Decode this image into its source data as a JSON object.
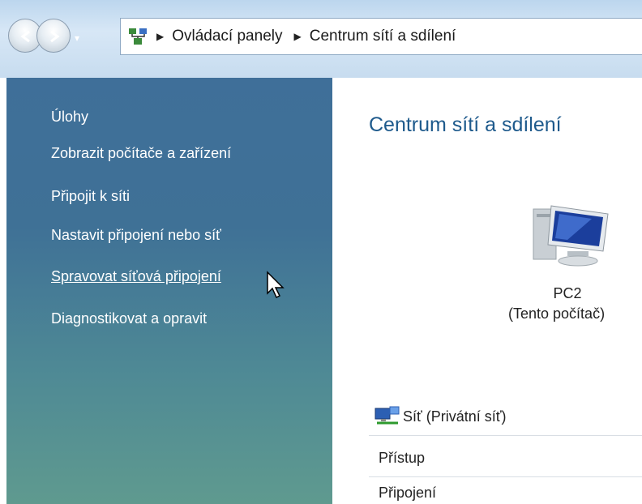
{
  "nav": {
    "back_icon": "back-arrow-icon",
    "forward_icon": "forward-arrow-icon",
    "dropdown_glyph": "▾"
  },
  "address_bar": {
    "icon": "control-panel-icon",
    "separator": "▶",
    "breadcrumbs": [
      "Ovládací panely",
      "Centrum sítí a sdílení"
    ]
  },
  "sidebar": {
    "links": [
      "Úlohy",
      "Zobrazit počítače a zařízení",
      "Připojit k síti",
      "Nastavit připojení nebo síť",
      "Spravovat síťová připojení",
      "Diagnostikovat a opravit"
    ]
  },
  "main": {
    "title": "Centrum sítí a sdílení",
    "computer": {
      "name": "PC2",
      "subtitle": "(Tento počítač)"
    },
    "network": {
      "name": "Síť (Privátní síť)",
      "rows": [
        "Přístup",
        "Připojení"
      ]
    }
  },
  "colors": {
    "title_blue": "#1e5a8c",
    "sidebar_top": "#3f6f99",
    "sidebar_bottom": "#5f9a8f"
  }
}
